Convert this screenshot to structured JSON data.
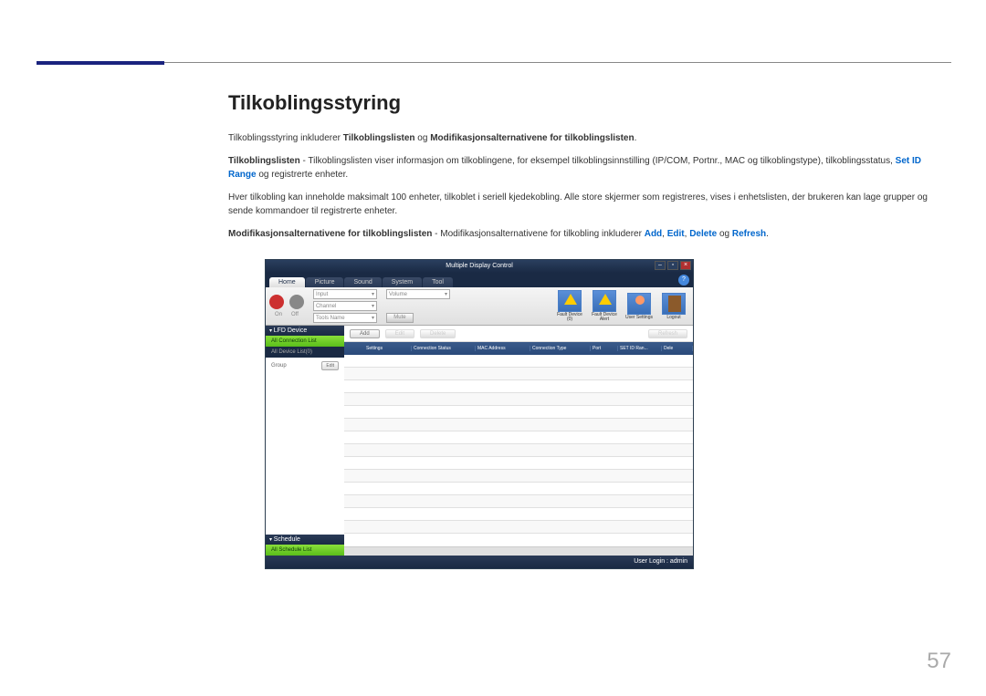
{
  "page": {
    "title": "Tilkoblingsstyring",
    "page_number": "57"
  },
  "para1": {
    "t1": "Tilkoblingsstyring inkluderer ",
    "b1": "Tilkoblingslisten",
    "t2": " og ",
    "b2": "Modifikasjonsalternativene for tilkoblingslisten",
    "t3": "."
  },
  "para2": {
    "b1": "Tilkoblingslisten",
    "t1": " - Tilkoblingslisten viser informasjon om tilkoblingene, for eksempel tilkoblingsinnstilling (IP/COM, Portnr., MAC og tilkoblingstype), tilkoblingsstatus, ",
    "link": "Set ID Range",
    "t2": " og registrerte enheter."
  },
  "para3": {
    "t1": "Hver tilkobling kan inneholde maksimalt 100 enheter, tilkoblet i seriell kjedekobling. Alle store skjermer som registreres, vises i enhetslisten, der brukeren kan lage grupper og sende kommandoer til registrerte enheter."
  },
  "para4": {
    "b1": "Modifikasjonsalternativene for tilkoblingslisten",
    "t1": " - Modifikasjonsalternativene for tilkobling inkluderer ",
    "l1": "Add",
    "s1": ", ",
    "l2": "Edit",
    "s2": ", ",
    "l3": "Delete",
    "t2": " og ",
    "l4": "Refresh",
    "t3": "."
  },
  "app": {
    "title": "Multiple Display Control",
    "tabs": [
      "Home",
      "Picture",
      "Sound",
      "System",
      "Tool"
    ],
    "power": {
      "on": "On",
      "off": "Off"
    },
    "combos": {
      "input": "Input",
      "channel": "Channel",
      "tools": "Tools Name",
      "volume": "Volume",
      "mute": "Mute"
    },
    "ricons": {
      "fd1": "Fault Device (0)",
      "fd2": "Fault Device Alert",
      "us": "User Settings",
      "lo": "Logout"
    },
    "sidebar": {
      "lfd": "LFD Device",
      "all_conn": "All Connection List",
      "all_dev": "All Device List(0)",
      "group": "Group",
      "edit": "Edit",
      "schedule": "Schedule",
      "all_sched": "All Schedule List"
    },
    "toolbar": {
      "add": "Add",
      "edit": "Edit",
      "delete": "Delete",
      "refresh": "Refresh"
    },
    "columns": [
      "",
      "Settings",
      "Connection Status",
      "MAC Address",
      "Connection Type",
      "Port",
      "SET ID Ran...",
      "Dele"
    ],
    "status": "User Login : admin"
  }
}
